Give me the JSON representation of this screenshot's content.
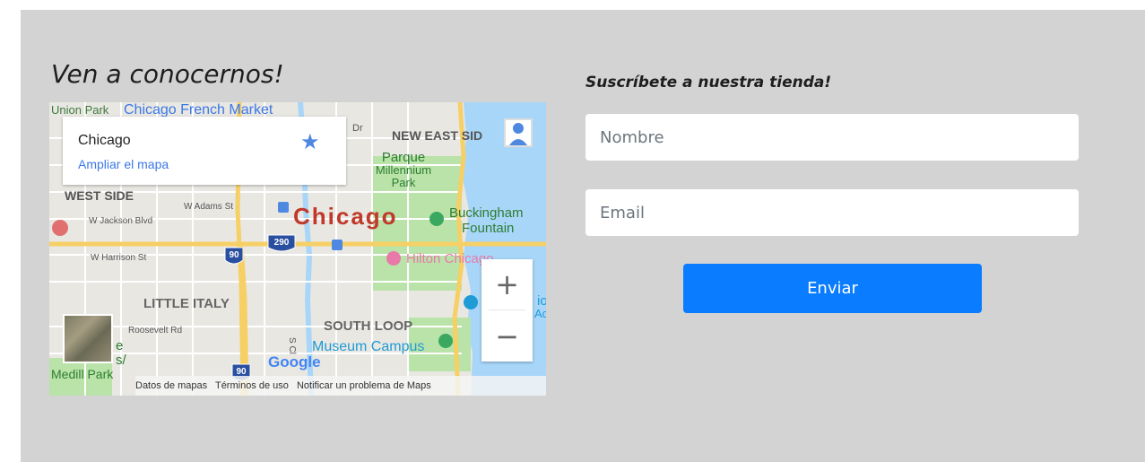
{
  "visit": {
    "title": "Ven a conocernos!"
  },
  "map": {
    "card": {
      "place": "Chicago",
      "expand_link": "Ampliar el mapa"
    },
    "labels": {
      "union_park": "Union Park",
      "french_market": "Chicago French Market",
      "dr": "Dr",
      "new_east_side": "NEW EAST SID",
      "parque": "Parque",
      "millennium": "Millennium",
      "park": "Park",
      "west_side": "WEST SIDE",
      "adams": "W Adams St",
      "city": "Chicago",
      "buckingham": "Buckingham",
      "fountain": "Fountain",
      "jackson": "W Jackson Blvd",
      "hilton": "Hilton Chicago",
      "harrison": "W Harrison St",
      "little_italy": "LITTLE ITALY",
      "roosevelt": "Roosevelt Rd",
      "south_loop": "SOUTH LOOP",
      "museum_campus": "Museum Campus",
      "medill": "Medill Park",
      "e": "e",
      "s": "s/",
      "io": "io",
      "ac": "Ac",
      "clark": "S Cl",
      "i90": "90",
      "i290": "290",
      "i90b": "90"
    },
    "logo": "Google",
    "zoom_in": "+",
    "zoom_out": "−",
    "attribution": {
      "data": "Datos de mapas",
      "terms": "Términos de uso",
      "report": "Notificar un problema de Maps"
    },
    "colors": {
      "water": "#a8d6f9",
      "park": "#b9e3a8",
      "highway": "#f6cf65",
      "city_label": "#c0392b"
    }
  },
  "subscribe": {
    "title": "Suscríbete a nuestra tienda!",
    "name_placeholder": "Nombre",
    "email_placeholder": "Email",
    "submit_label": "Enviar",
    "button_color": "#0a7cff"
  }
}
